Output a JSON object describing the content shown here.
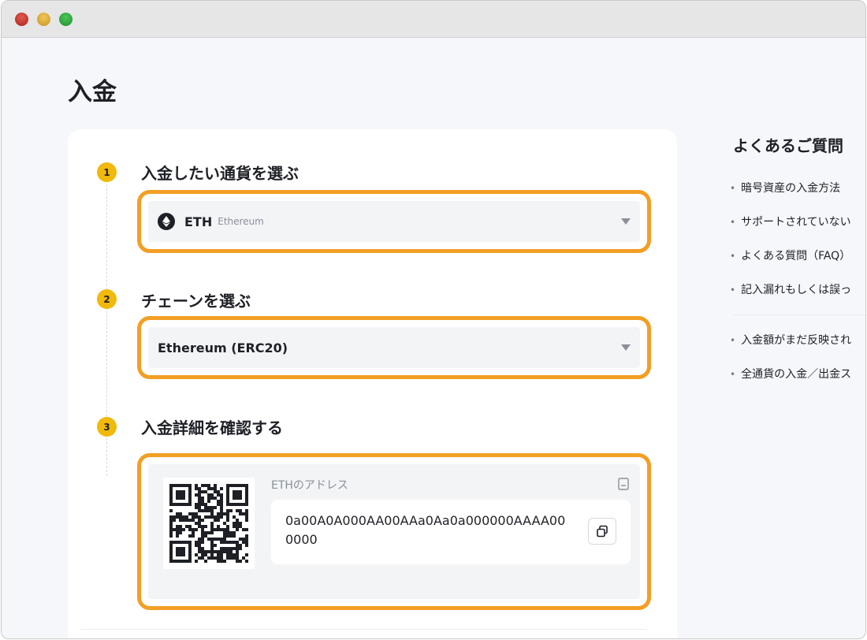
{
  "page": {
    "title": "入金"
  },
  "steps": [
    {
      "number": "1",
      "title": "入金したい通貨を選ぶ"
    },
    {
      "number": "2",
      "title": "チェーンを選ぶ"
    },
    {
      "number": "3",
      "title": "入金詳細を確認する"
    }
  ],
  "coin_select": {
    "symbol": "ETH",
    "name": "Ethereum"
  },
  "chain_select": {
    "value": "Ethereum (ERC20)"
  },
  "deposit_detail": {
    "address_label": "ETHのアドレス",
    "address": "0a00A0A000AA00AAa0Aa0a000000AAAA000000"
  },
  "faq": {
    "title": "よくあるご質問",
    "items": [
      "暗号資産の入金方法",
      "サポートされていない",
      "よくある質問（FAQ）",
      "記入漏れもしくは誤っ",
      "入金額がまだ反映され",
      "全通貨の入金／出金ス"
    ]
  },
  "colors": {
    "accent": "#f0b90b",
    "highlight": "#f29f25",
    "text": "#1e2026",
    "muted": "#8a8f99"
  },
  "icons": [
    "ethereum-logo-icon",
    "chevron-down-icon",
    "qr-code-icon",
    "copy-icon",
    "address-book-icon"
  ]
}
